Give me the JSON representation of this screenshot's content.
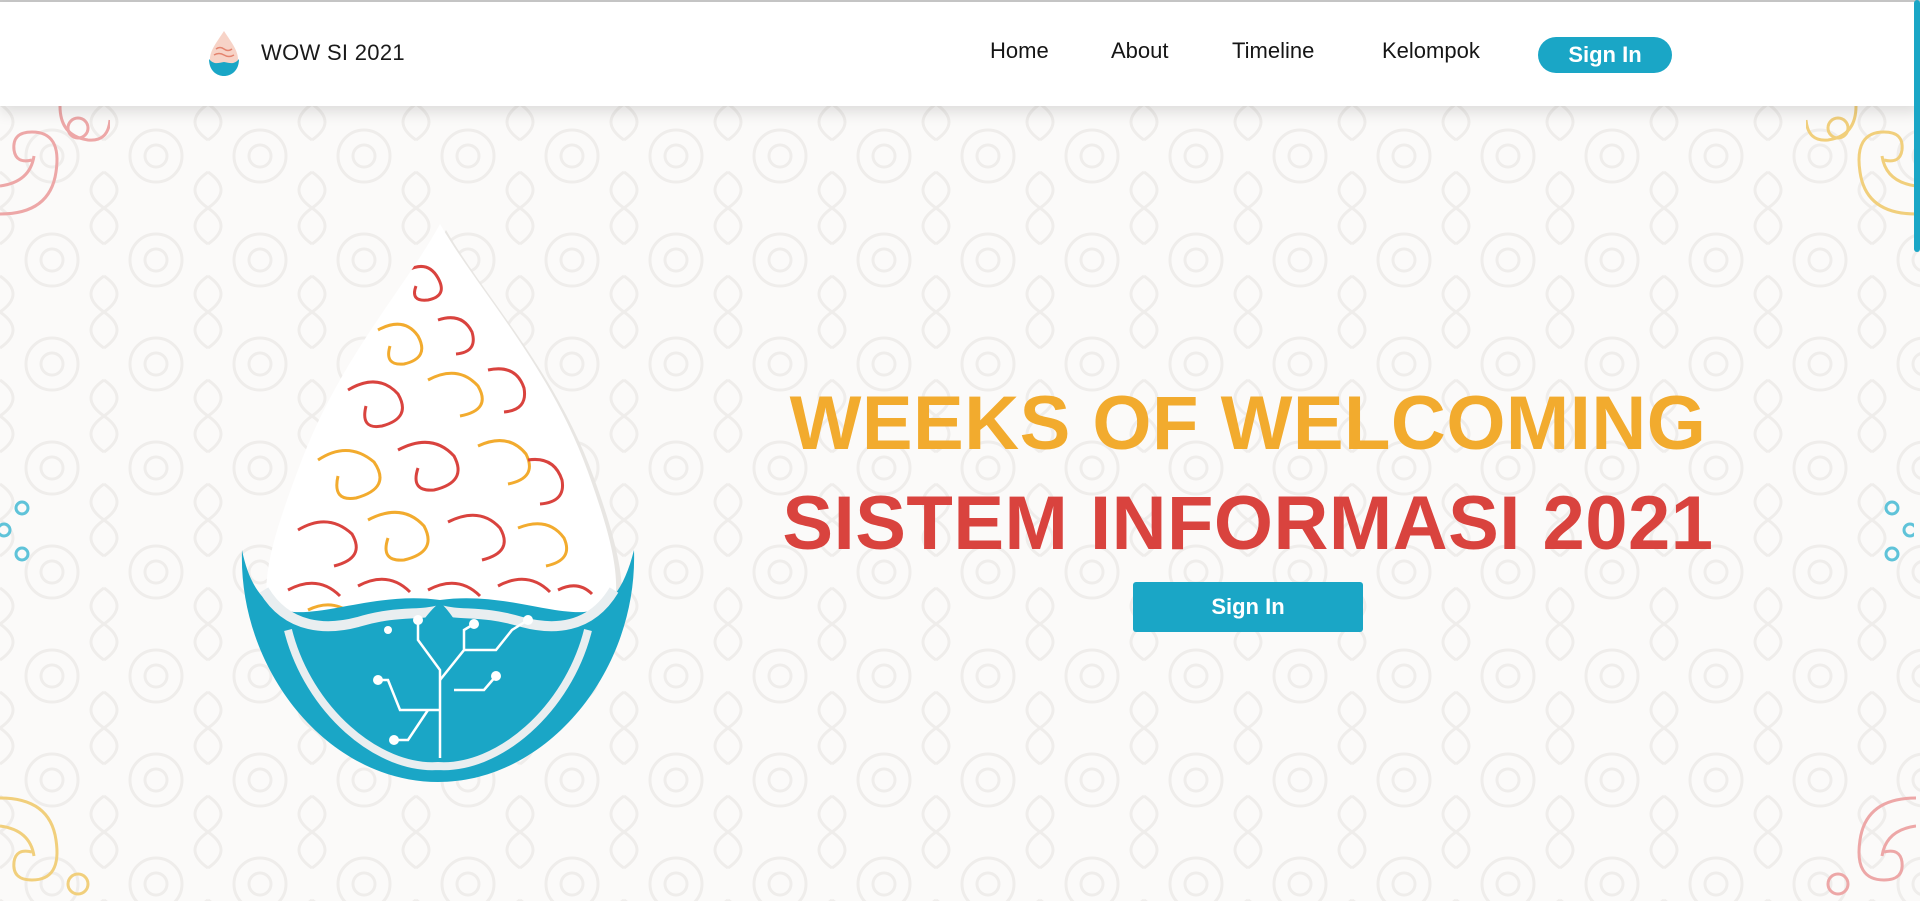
{
  "navbar": {
    "brand_name": "WOW SI 2021",
    "links": [
      "Home",
      "About",
      "Timeline",
      "Kelompok"
    ],
    "signin_label": "Sign In"
  },
  "hero": {
    "title_line1": "WEEKS OF WELCOMING",
    "title_line2": "SISTEM INFORMASI 2021",
    "signin_label": "Sign In"
  },
  "colors": {
    "accent": "#1aa6c6",
    "title1": "#f2ab2e",
    "title2": "#d9433e",
    "background": "#fbfaf9"
  },
  "icons": [
    "logo-icon",
    "corner-ornament-icon",
    "circle-dots-icon"
  ]
}
